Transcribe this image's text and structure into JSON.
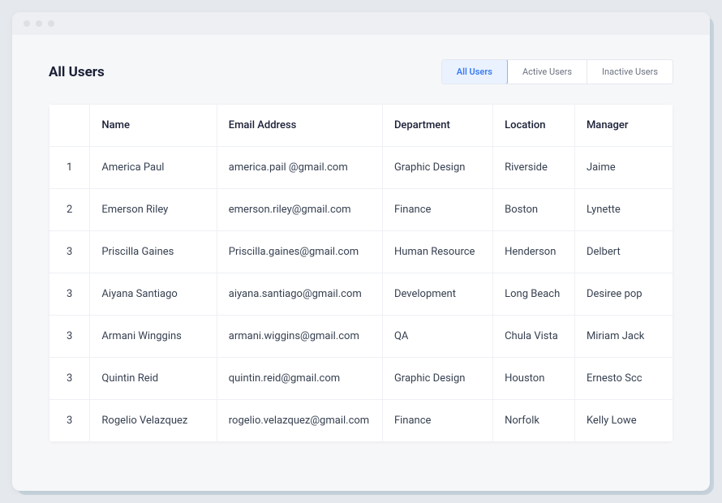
{
  "page_title": "All Users",
  "tabs": [
    {
      "label": "All Users",
      "active": true
    },
    {
      "label": "Active Users",
      "active": false
    },
    {
      "label": "Inactive Users",
      "active": false
    }
  ],
  "columns": {
    "idx": "",
    "name": "Name",
    "email": "Email Address",
    "dept": "Department",
    "loc": "Location",
    "mgr": "Manager"
  },
  "rows": [
    {
      "idx": "1",
      "name": "America Paul",
      "email": "america.pail @gmail.com",
      "dept": "Graphic Design",
      "loc": "Riverside",
      "mgr": "Jaime"
    },
    {
      "idx": "2",
      "name": "Emerson Riley",
      "email": "emerson.riley@gmail.com",
      "dept": "Finance",
      "loc": "Boston",
      "mgr": "Lynette"
    },
    {
      "idx": "3",
      "name": "Priscilla Gaines",
      "email": "Priscilla.gaines@gmail.com",
      "dept": "Human Resource",
      "loc": "Henderson",
      "mgr": "Delbert"
    },
    {
      "idx": "3",
      "name": "Aiyana Santiago",
      "email": "aiyana.santiago@gmail.com",
      "dept": "Development",
      "loc": "Long Beach",
      "mgr": "Desiree pop"
    },
    {
      "idx": "3",
      "name": "Armani Winggins",
      "email": "armani.wiggins@gmail.com",
      "dept": "QA",
      "loc": "Chula Vista",
      "mgr": "Miriam Jack"
    },
    {
      "idx": "3",
      "name": "Quintin Reid",
      "email": "quintin.reid@gmail.com",
      "dept": "Graphic Design",
      "loc": "Houston",
      "mgr": "Ernesto Scc"
    },
    {
      "idx": "3",
      "name": "Rogelio Velazquez",
      "email": "rogelio.velazquez@gmail.com",
      "dept": "Finance",
      "loc": "Norfolk",
      "mgr": "Kelly Lowe"
    }
  ]
}
